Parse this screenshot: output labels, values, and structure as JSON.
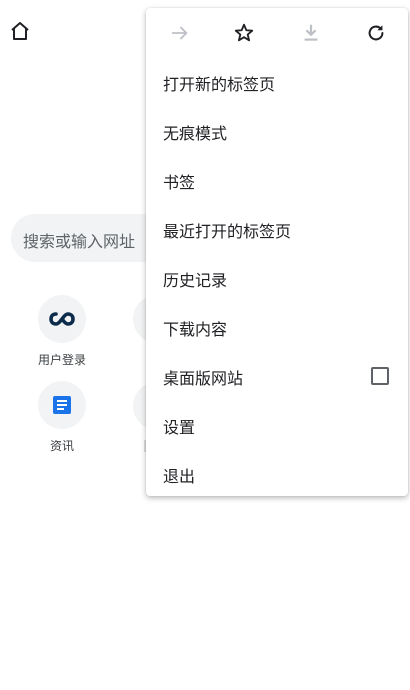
{
  "search": {
    "placeholder": "搜索或输入网址"
  },
  "tiles": [
    {
      "label": "用户登录",
      "icon": "infinity-logo-icon"
    },
    {
      "label": "资讯",
      "icon": "news-doc-icon"
    }
  ],
  "menu": {
    "toolbar": [
      {
        "icon": "forward-arrow-icon",
        "enabled": false
      },
      {
        "icon": "star-bookmark-icon",
        "enabled": true
      },
      {
        "icon": "download-icon",
        "enabled": false
      },
      {
        "icon": "reload-icon",
        "enabled": true
      }
    ],
    "items": [
      {
        "label": "打开新的标签页"
      },
      {
        "label": "无痕模式"
      },
      {
        "label": "书签"
      },
      {
        "label": "最近打开的标签页"
      },
      {
        "label": "历史记录"
      },
      {
        "label": "下载内容"
      },
      {
        "label": "桌面版网站",
        "checkbox": false
      },
      {
        "label": "设置"
      },
      {
        "label": "退出"
      }
    ]
  },
  "colors": {
    "accent": "#1a73e8",
    "logo_dark": "#0d2b4a",
    "disabled": "#bdc1c6",
    "icon": "#3c4043"
  }
}
